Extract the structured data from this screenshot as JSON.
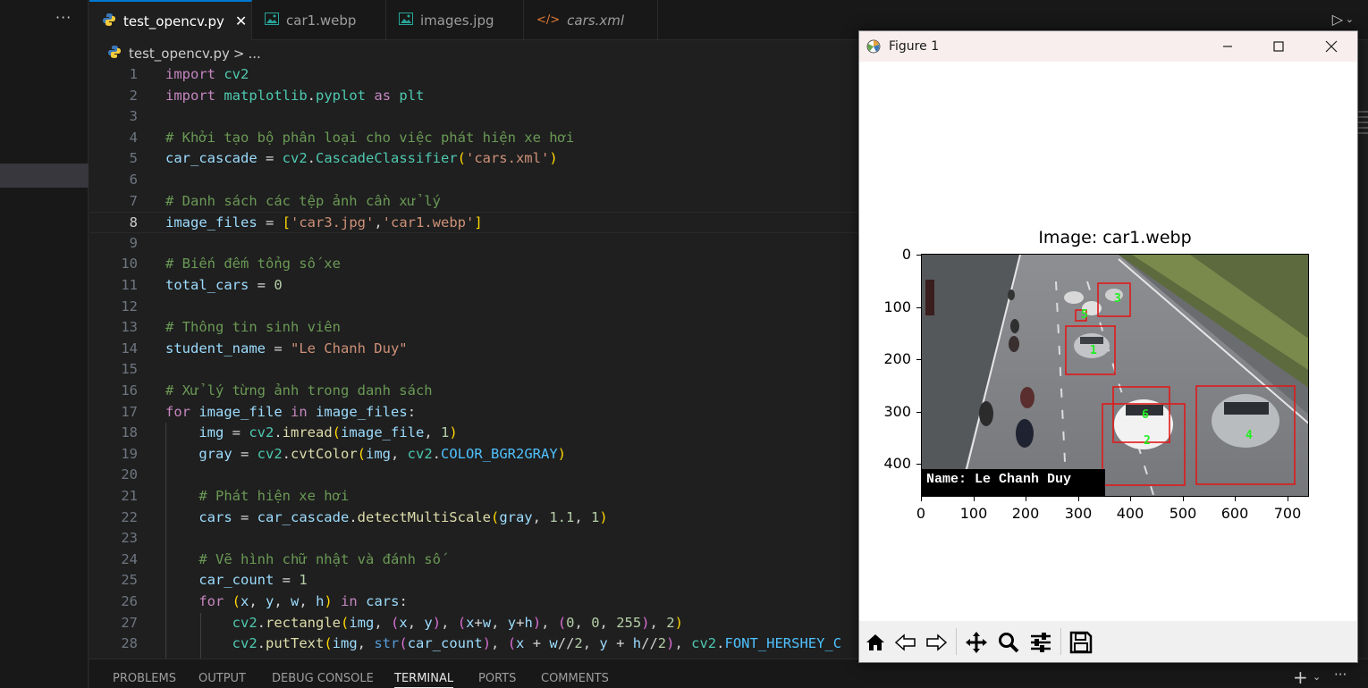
{
  "sidebar": {
    "more_label": "···"
  },
  "tabs": [
    {
      "label": "test_opencv.py",
      "icon": "python-icon",
      "active": true
    },
    {
      "label": "car1.webp",
      "icon": "image-icon"
    },
    {
      "label": "images.jpg",
      "icon": "image-icon"
    },
    {
      "label": "cars.xml",
      "icon": "xml-code-icon"
    }
  ],
  "tab_icons": {
    "xml": "</>"
  },
  "breadcrumb": {
    "file": "test_opencv.py",
    "sep": ">",
    "rest": "..."
  },
  "editor": {
    "current_line": 8,
    "lines": [
      {
        "n": "1"
      },
      {
        "n": "2"
      },
      {
        "n": "3"
      },
      {
        "n": "4"
      },
      {
        "n": "5"
      },
      {
        "n": "6"
      },
      {
        "n": "7"
      },
      {
        "n": "8"
      },
      {
        "n": "9"
      },
      {
        "n": "10"
      },
      {
        "n": "11"
      },
      {
        "n": "12"
      },
      {
        "n": "13"
      },
      {
        "n": "14"
      },
      {
        "n": "15"
      },
      {
        "n": "16"
      },
      {
        "n": "17"
      },
      {
        "n": "18"
      },
      {
        "n": "19"
      },
      {
        "n": "20"
      },
      {
        "n": "21"
      },
      {
        "n": "22"
      },
      {
        "n": "23"
      },
      {
        "n": "24"
      },
      {
        "n": "25"
      },
      {
        "n": "26"
      },
      {
        "n": "27"
      },
      {
        "n": "28"
      }
    ],
    "code": {
      "l1": [
        "import",
        " ",
        "cv2"
      ],
      "l2": [
        "import",
        " ",
        "matplotlib",
        ".",
        "pyplot",
        " ",
        "as",
        " ",
        "plt"
      ],
      "l4": "# Khởi tạo bộ phân loại cho việc phát hiện xe hơi",
      "l5": [
        "car_cascade",
        " = ",
        "cv2",
        ".",
        "CascadeClassifier",
        "(",
        "'cars.xml'",
        ")"
      ],
      "l7": "# Danh sách các tệp ảnh cần xử lý",
      "l8": [
        "image_files",
        " = ",
        "[",
        "'car3.jpg'",
        ",",
        "'car1.webp'",
        "]"
      ],
      "l10": "# Biến đếm tổng số xe",
      "l11": [
        "total_cars",
        " = ",
        "0"
      ],
      "l13": "# Thông tin sinh viên",
      "l14": [
        "student_name",
        " = ",
        "\"Le Chanh Duy\""
      ],
      "l16": "# Xử lý từng ảnh trong danh sách",
      "l17": [
        "for",
        " ",
        "image_file",
        " ",
        "in",
        " ",
        "image_files",
        ":"
      ],
      "l18": [
        "    ",
        "img",
        " = ",
        "cv2",
        ".",
        "imread",
        "(",
        "image_file",
        ", ",
        "1",
        ")"
      ],
      "l19": [
        "    ",
        "gray",
        " = ",
        "cv2",
        ".",
        "cvtColor",
        "(",
        "img",
        ", ",
        "cv2",
        ".",
        "COLOR_BGR2GRAY",
        ")"
      ],
      "l21": "    # Phát hiện xe hơi",
      "l22": [
        "    ",
        "cars",
        " = ",
        "car_cascade",
        ".",
        "detectMultiScale",
        "(",
        "gray",
        ", ",
        "1.1",
        ", ",
        "1",
        ")"
      ],
      "l24": "    # Vẽ hình chữ nhật và đánh số",
      "l25": [
        "    ",
        "car_count",
        " = ",
        "1"
      ],
      "l26": [
        "    ",
        "for",
        " ",
        "(",
        "x",
        ", ",
        "y",
        ", ",
        "w",
        ", ",
        "h",
        ")",
        " ",
        "in",
        " ",
        "cars",
        ":"
      ],
      "l27": [
        "        ",
        "cv2",
        ".",
        "rectangle",
        "(",
        "img",
        ", ",
        "(",
        "x",
        ", ",
        "y",
        ")",
        ", ",
        "(",
        "x",
        "+",
        "w",
        ", ",
        "y",
        "+",
        "h",
        ")",
        ", ",
        "(",
        "0",
        ", ",
        "0",
        ", ",
        "255",
        ")",
        ", ",
        "2",
        ")"
      ],
      "l28": [
        "        ",
        "cv2",
        ".",
        "putText",
        "(",
        "img",
        ", ",
        "str",
        "(",
        "car_count",
        ")",
        ", ",
        "(",
        "x",
        " + ",
        "w",
        "//",
        "2",
        ", ",
        "y",
        " + ",
        "h",
        "//",
        "2",
        ")",
        ", ",
        "cv2",
        ".",
        "FONT_HERSHEY_C"
      ]
    }
  },
  "panel": {
    "tabs": [
      "PROBLEMS",
      "OUTPUT",
      "DEBUG CONSOLE",
      "TERMINAL",
      "PORTS",
      "COMMENTS"
    ],
    "active": "TERMINAL",
    "plus": "+",
    "more": "···"
  },
  "figure": {
    "title": "Figure 1",
    "plot_title": "Image: car1.webp",
    "name_label": "Name: Le Chanh Duy",
    "y_ticks": [
      "0",
      "100",
      "200",
      "300",
      "400"
    ],
    "x_ticks": [
      "0",
      "100",
      "200",
      "300",
      "400",
      "500",
      "600",
      "700"
    ],
    "detections": [
      "1",
      "2",
      "3",
      "4",
      "5",
      "6"
    ],
    "toolbar": [
      "home-icon",
      "back-icon",
      "forward-icon",
      "pan-icon",
      "zoom-icon",
      "configure-icon",
      "save-icon"
    ]
  }
}
